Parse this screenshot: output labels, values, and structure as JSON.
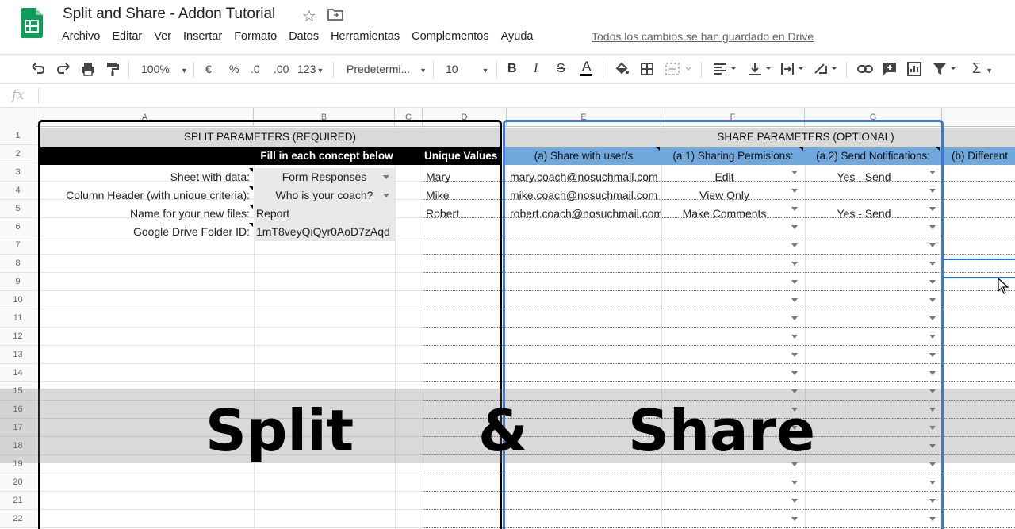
{
  "app": {
    "title": "Split and Share - Addon Tutorial",
    "menu": [
      "Archivo",
      "Editar",
      "Ver",
      "Insertar",
      "Formato",
      "Datos",
      "Herramientas",
      "Complementos",
      "Ayuda"
    ],
    "saved_status": "Todos los cambios se han guardado en Drive",
    "brand_color": "#0f9d58"
  },
  "toolbar": {
    "zoom": "100%",
    "currency": "€",
    "percent": "%",
    "dec_less": ".0",
    "dec_more": ".00",
    "format_more": "123",
    "font": "Predetermi...",
    "font_size": "10",
    "bold": "B",
    "italic": "I",
    "strike": "S",
    "text_color": "A",
    "sum": "Σ"
  },
  "formula_bar": {
    "icon": "fx",
    "value": ""
  },
  "columns": [
    "A",
    "B",
    "C",
    "D",
    "E",
    "F",
    "G"
  ],
  "rows": [
    "1",
    "2",
    "3",
    "4",
    "5",
    "6",
    "7",
    "8",
    "9",
    "10",
    "11",
    "12",
    "13",
    "14",
    "15",
    "16",
    "17",
    "18",
    "19",
    "20",
    "21",
    "22"
  ],
  "split": {
    "header": "SPLIT PARAMETERS (REQUIRED)",
    "subheader": "Fill in each concept below",
    "unique_values_header": "Unique Values",
    "params": [
      {
        "label": "Sheet with data:",
        "value": "Form Responses"
      },
      {
        "label": "Column Header (with unique criteria):",
        "value": "Who is your coach?"
      },
      {
        "label": "Name for your new files:",
        "value": "Report"
      },
      {
        "label": "Google Drive Folder ID:",
        "value": "1mT8veyQiQyr0AoD7zAqd"
      }
    ],
    "unique_values": [
      "Mary",
      "Mike",
      "Robert"
    ]
  },
  "share": {
    "header": "SHARE PARAMETERS (OPTIONAL)",
    "col_users": "(a) Share with user/s",
    "col_perms": "(a.1) Sharing Permisions:",
    "col_notif": "(a.2) Send Notifications:",
    "col_different": "(b) Different",
    "rows": [
      {
        "email": "mary.coach@nosuchmail.com",
        "permission": "Edit",
        "notify": "Yes - Send"
      },
      {
        "email": "mike.coach@nosuchmail.com",
        "permission": "View Only",
        "notify": ""
      },
      {
        "email": "robert.coach@nosuchmail.com",
        "permission": "Make Comments",
        "notify": "Yes - Send"
      }
    ]
  },
  "overlay": {
    "word1": "Split",
    "word2": "&",
    "word3": "Share"
  }
}
